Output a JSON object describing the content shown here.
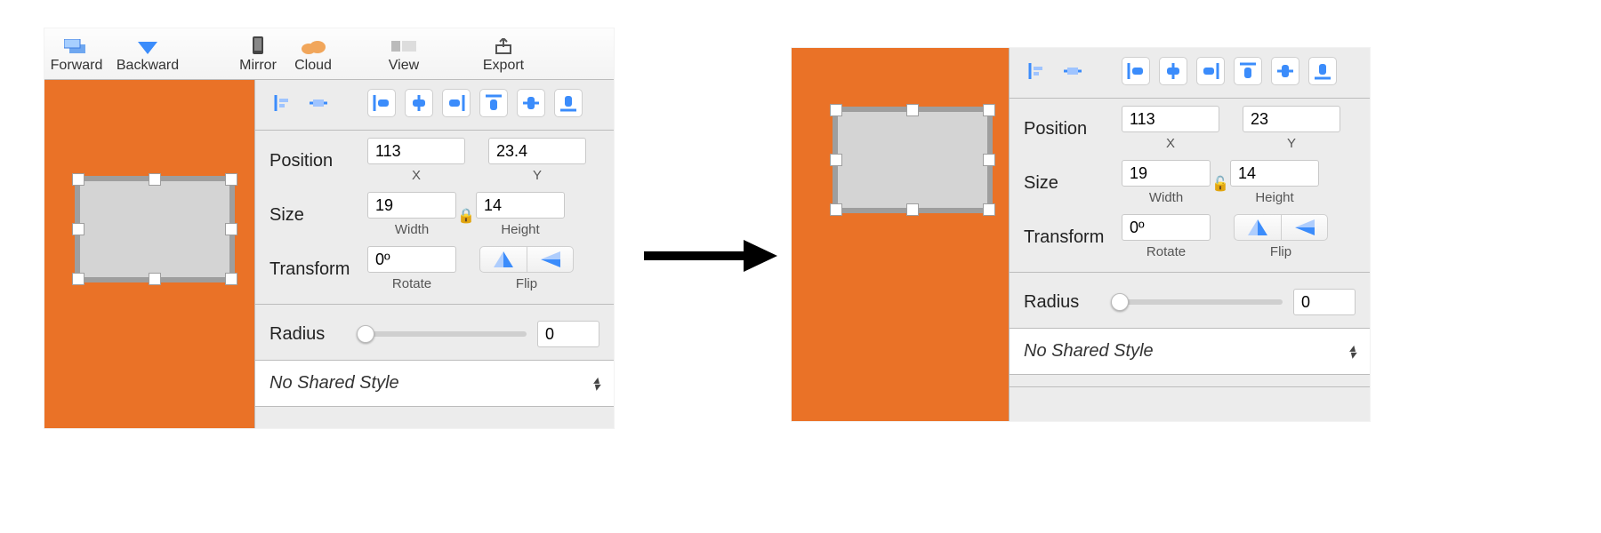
{
  "left": {
    "toolbar": {
      "items": [
        {
          "label": "Forward"
        },
        {
          "label": "Backward"
        },
        {
          "label": "Mirror"
        },
        {
          "label": "Cloud"
        },
        {
          "label": "View"
        },
        {
          "label": "Export"
        }
      ]
    },
    "inspector": {
      "position_label": "Position",
      "x_value": "113",
      "x_sub": "X",
      "y_value": "23.4",
      "y_sub": "Y",
      "size_label": "Size",
      "w_value": "19",
      "w_sub": "Width",
      "h_value": "14",
      "h_sub": "Height",
      "transform_label": "Transform",
      "rotate_value": "0º",
      "rotate_sub": "Rotate",
      "flip_sub": "Flip",
      "radius_label": "Radius",
      "radius_value": "0",
      "shared_style": "No Shared Style"
    }
  },
  "right": {
    "inspector": {
      "position_label": "Position",
      "x_value": "113",
      "x_sub": "X",
      "y_value": "23",
      "y_sub": "Y",
      "size_label": "Size",
      "w_value": "19",
      "w_sub": "Width",
      "h_value": "14",
      "h_sub": "Height",
      "transform_label": "Transform",
      "rotate_value": "0º",
      "rotate_sub": "Rotate",
      "flip_sub": "Flip",
      "radius_label": "Radius",
      "radius_value": "0",
      "shared_style": "No Shared Style"
    }
  }
}
